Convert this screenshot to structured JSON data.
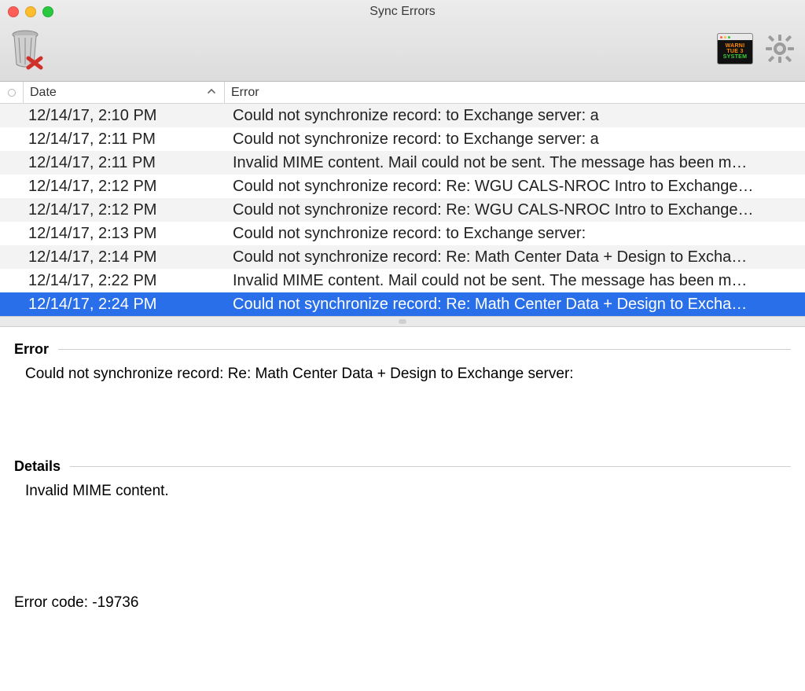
{
  "window": {
    "title": "Sync Errors"
  },
  "toolbar": {
    "delete_label": "Delete",
    "warnings_label": "Warnings",
    "settings_label": "Settings"
  },
  "columns": {
    "date": "Date",
    "error": "Error",
    "sort_indicator": "˄"
  },
  "rows": [
    {
      "date": "12/14/17, 2:10 PM",
      "error": "Could not synchronize record:  to Exchange server: a"
    },
    {
      "date": "12/14/17, 2:11 PM",
      "error": "Could not synchronize record:  to Exchange server: a"
    },
    {
      "date": "12/14/17, 2:11 PM",
      "error": "Invalid MIME content. Mail could not be sent. The message has been m…"
    },
    {
      "date": "12/14/17, 2:12 PM",
      "error": "Could not synchronize record: Re: WGU CALS-NROC Intro to Exchange…"
    },
    {
      "date": "12/14/17, 2:12 PM",
      "error": "Could not synchronize record: Re: WGU CALS-NROC Intro to Exchange…"
    },
    {
      "date": "12/14/17, 2:13 PM",
      "error": "Could not synchronize record:  to Exchange server:"
    },
    {
      "date": "12/14/17, 2:14 PM",
      "error": "Could not synchronize record: Re: Math Center Data + Design to Excha…"
    },
    {
      "date": "12/14/17, 2:22 PM",
      "error": "Invalid MIME content. Mail could not be sent. The message has been m…"
    },
    {
      "date": "12/14/17, 2:24 PM",
      "error": "Could not synchronize record: Re: Math Center Data + Design to Excha…"
    }
  ],
  "selected_index": 8,
  "detail": {
    "error_heading": "Error",
    "error_text": "Could not synchronize record: Re: Math Center Data + Design to Exchange server:",
    "details_heading": "Details",
    "details_text": "Invalid MIME content.",
    "error_code_label": "Error code: -19736"
  }
}
